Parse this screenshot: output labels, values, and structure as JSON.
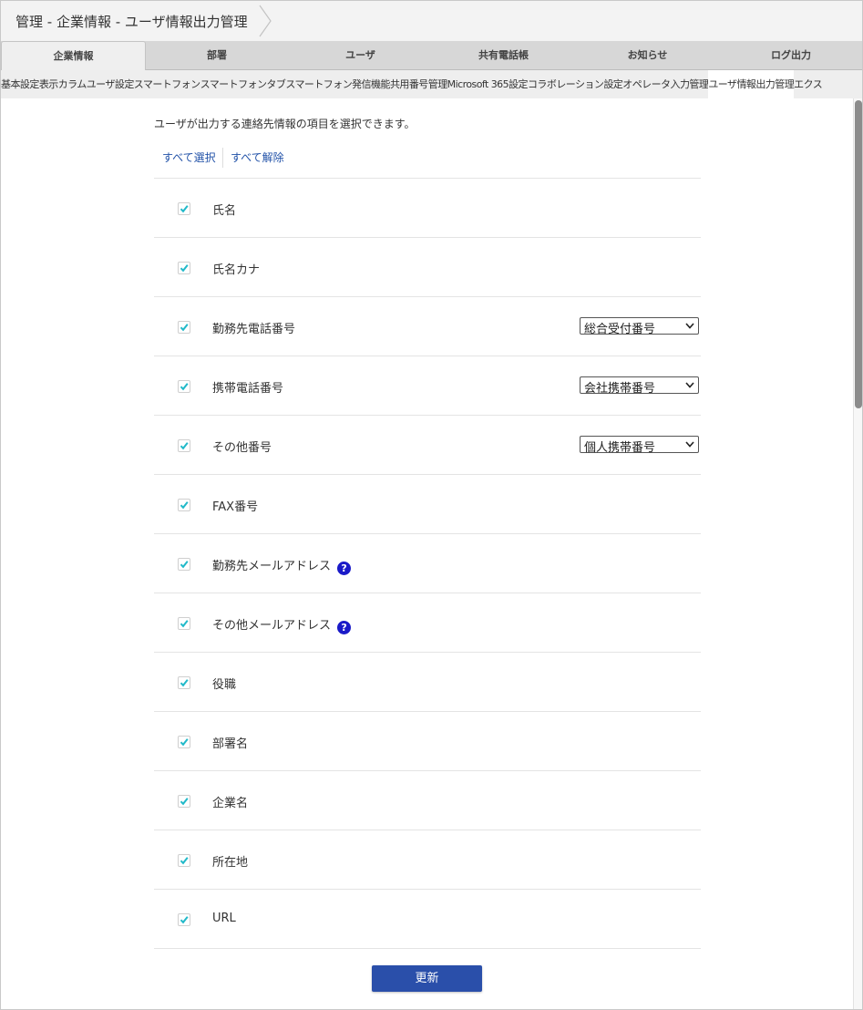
{
  "breadcrumb": {
    "text": "管理 - 企業情報 - ユーザ情報出力管理"
  },
  "main_tabs": [
    {
      "label": "企業情報",
      "active": true
    },
    {
      "label": "部署"
    },
    {
      "label": "ユーザ"
    },
    {
      "label": "共有電話帳"
    },
    {
      "label": "お知らせ"
    },
    {
      "label": "ログ出力"
    }
  ],
  "sub_tabs": [
    {
      "label": "基本設定"
    },
    {
      "label": "表示カラム"
    },
    {
      "label": "ユーザ設定"
    },
    {
      "label": "スマートフォン"
    },
    {
      "label": "スマートフォン"
    },
    {
      "label": "タブ"
    },
    {
      "label": "スマートフォン発信機能"
    },
    {
      "label": "共用番号管理"
    },
    {
      "label": "Microsoft 365設定"
    },
    {
      "label": "コラボレーション設定"
    },
    {
      "label": "オペレータ入力管理"
    },
    {
      "label": "ユーザ情報出力管理",
      "active": true
    },
    {
      "label": "エクス"
    }
  ],
  "description": "ユーザが出力する連絡先情報の項目を選択できます。",
  "links": {
    "select_all": "すべて選択",
    "deselect_all": "すべて解除"
  },
  "fields": [
    {
      "label": "氏名",
      "checked": true
    },
    {
      "label": "氏名カナ",
      "checked": true
    },
    {
      "label": "勤務先電話番号",
      "checked": true,
      "select": "総合受付番号"
    },
    {
      "label": "携帯電話番号",
      "checked": true,
      "select": "会社携帯番号"
    },
    {
      "label": "その他番号",
      "checked": true,
      "select": "個人携帯番号"
    },
    {
      "label": "FAX番号",
      "checked": true
    },
    {
      "label": "勤務先メールアドレス",
      "checked": true,
      "help": "?"
    },
    {
      "label": "その他メールアドレス",
      "checked": true,
      "help": "?"
    },
    {
      "label": "役職",
      "checked": true
    },
    {
      "label": "部署名",
      "checked": true
    },
    {
      "label": "企業名",
      "checked": true
    },
    {
      "label": "所在地",
      "checked": true
    },
    {
      "label": "URL",
      "checked": true
    }
  ],
  "update_button": "更新",
  "colors": {
    "accent": "#2a4faa",
    "check": "#21b9c9",
    "link": "#2252a8",
    "help": "#1a1ac8"
  }
}
